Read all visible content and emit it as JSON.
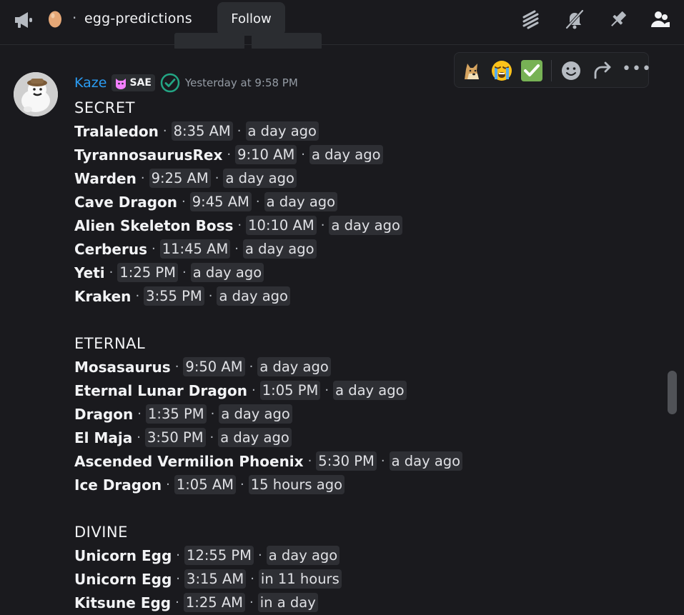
{
  "header": {
    "channel_name": "egg-predictions",
    "dot": "·",
    "follow_label": "Follow",
    "icons": [
      "announcement-megaphone-icon",
      "egg-icon",
      "threads-icon",
      "notifications-muted-icon",
      "pin-icon",
      "members-icon"
    ]
  },
  "toolbar": {
    "reactions": [
      "doge-emoji",
      "loudly-crying-emoji",
      "check-mark-emoji"
    ],
    "actions": [
      "add-reaction-icon",
      "forward-icon",
      "more-icon"
    ],
    "more_label": "•••"
  },
  "message": {
    "author": "Kaze",
    "author_color": "#2b9cf2",
    "role_tag": "SAE",
    "timestamp": "Yesterday at 9:58 PM",
    "separator": "·",
    "sections": [
      {
        "heading": "SECRET",
        "items": [
          {
            "name": "Tralaledon",
            "time": "8:35 AM",
            "relative": "a day ago"
          },
          {
            "name": "TyrannosaurusRex",
            "time": "9:10 AM",
            "relative": "a day ago"
          },
          {
            "name": "Warden",
            "time": "9:25 AM",
            "relative": "a day ago"
          },
          {
            "name": "Cave Dragon",
            "time": "9:45 AM",
            "relative": "a day ago"
          },
          {
            "name": "Alien Skeleton Boss",
            "time": "10:10 AM",
            "relative": "a day ago"
          },
          {
            "name": "Cerberus",
            "time": "11:45 AM",
            "relative": "a day ago"
          },
          {
            "name": "Yeti",
            "time": "1:25 PM",
            "relative": "a day ago"
          },
          {
            "name": "Kraken",
            "time": "3:55 PM",
            "relative": "a day ago"
          }
        ]
      },
      {
        "heading": "ETERNAL",
        "items": [
          {
            "name": "Mosasaurus",
            "time": "9:50 AM",
            "relative": "a day ago"
          },
          {
            "name": "Eternal Lunar Dragon",
            "time": "1:05 PM",
            "relative": "a day ago"
          },
          {
            "name": "Dragon",
            "time": "1:35 PM",
            "relative": "a day ago"
          },
          {
            "name": "El Maja",
            "time": "3:50 PM",
            "relative": "a day ago"
          },
          {
            "name": "Ascended Vermilion Phoenix",
            "time": "5:30 PM",
            "relative": "a day ago"
          },
          {
            "name": "Ice Dragon",
            "time": "1:05 AM",
            "relative": "15 hours ago"
          }
        ]
      },
      {
        "heading": "DIVINE",
        "items": [
          {
            "name": "Unicorn Egg",
            "time": "12:55 PM",
            "relative": "a day ago"
          },
          {
            "name": "Unicorn Egg",
            "time": "3:15 AM",
            "relative": "in 11 hours"
          },
          {
            "name": "Kitsune Egg",
            "time": "1:25 AM",
            "relative": "in a day"
          }
        ]
      }
    ]
  }
}
